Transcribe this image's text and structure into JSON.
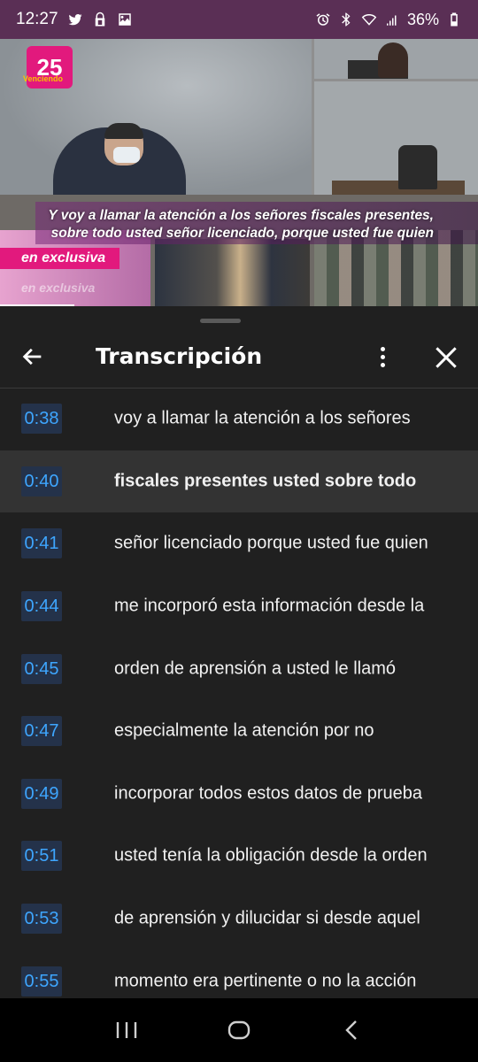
{
  "status_bar": {
    "time": "12:27",
    "battery": "36%",
    "left_icons": [
      "twitter-icon",
      "lock-icon",
      "image-icon"
    ],
    "right_icons": [
      "alarm-icon",
      "bluetooth-icon",
      "wifi-icon",
      "signal-icon",
      "battery-icon"
    ],
    "background": "#5a2f55"
  },
  "video": {
    "caption_line1": "Y voy a llamar la atención a los señores fiscales presentes,",
    "caption_line2": "sobre todo usted señor licenciado, porque usted fue quien",
    "tag": "en exclusiva",
    "tag_faded": "en exclusiva",
    "logo_text": "25",
    "logo_sub": "Venciendo",
    "progress": 0.155
  },
  "transcript": {
    "title": "Transcripción",
    "active_index": 1,
    "rows": [
      {
        "time": "0:38",
        "text": "voy a llamar la atención a los señores"
      },
      {
        "time": "0:40",
        "text": "fiscales presentes usted sobre todo"
      },
      {
        "time": "0:41",
        "text": "señor licenciado porque usted fue quien"
      },
      {
        "time": "0:44",
        "text": "me incorporó esta información desde la"
      },
      {
        "time": "0:45",
        "text": "orden de aprensión a usted le llamó"
      },
      {
        "time": "0:47",
        "text": "especialmente la atención por no"
      },
      {
        "time": "0:49",
        "text": "incorporar todos estos datos de prueba"
      },
      {
        "time": "0:51",
        "text": "usted tenía la obligación desde la orden"
      },
      {
        "time": "0:53",
        "text": "de aprensión y dilucidar si desde aquel"
      },
      {
        "time": "0:55",
        "text": "momento era pertinente o no la acción"
      }
    ]
  },
  "colors": {
    "timestamp_text": "#3ea6ff",
    "timestamp_bg": "#24324a",
    "panel_bg": "#202020",
    "active_row_bg": "#333333",
    "brand_pink": "#e2197d"
  }
}
